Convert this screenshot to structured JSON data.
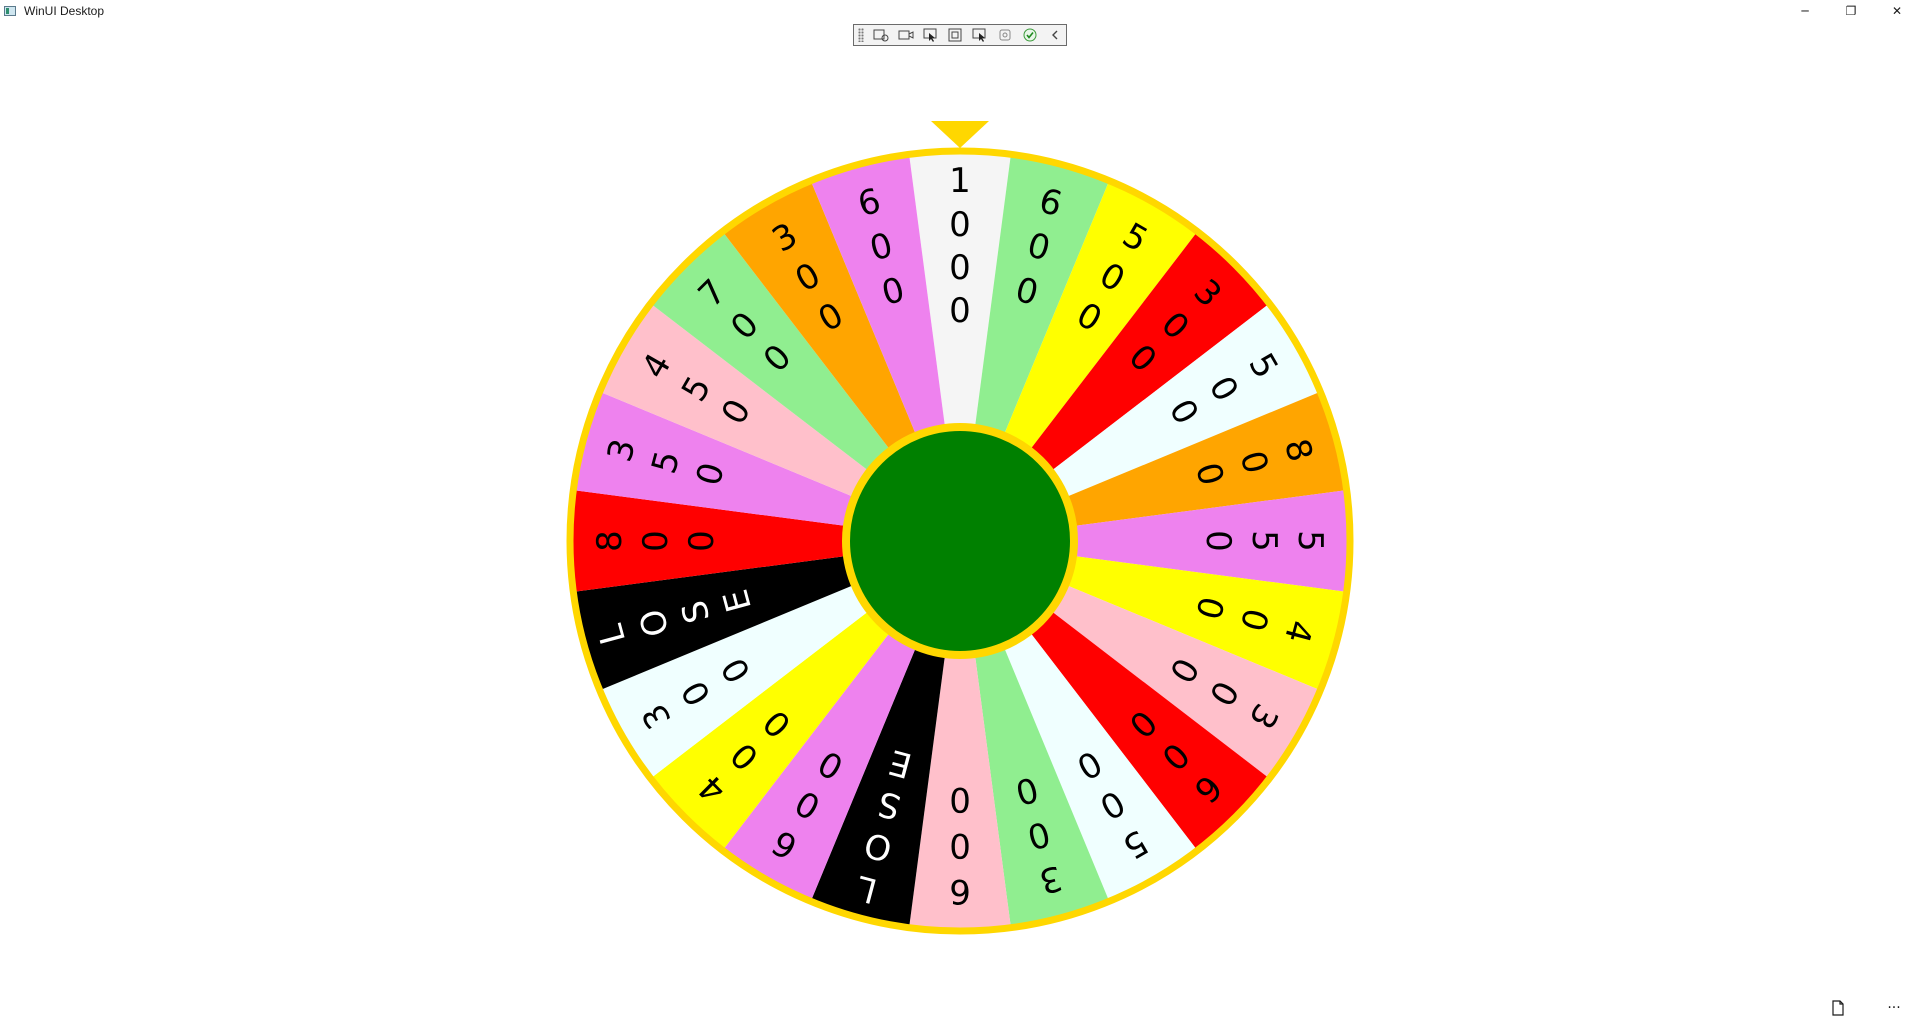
{
  "window": {
    "title": "WinUI Desktop"
  },
  "caption": {
    "minimize": "─",
    "restore": "❐",
    "close": "✕"
  },
  "toolbar": {
    "icons": [
      "grip-icon",
      "inspect-tree-icon",
      "video-icon",
      "select-element-icon",
      "display-layout-icon",
      "track-focus-icon",
      "hot-reload-icon",
      "ok-check-icon",
      "collapse-chevron-icon"
    ]
  },
  "wheel": {
    "rim_color": "#FFD700",
    "hub_color": "#008000",
    "pointer_color": "#FFD700",
    "segments": [
      {
        "label": "1000",
        "color": "#F5F5F5",
        "text_color": "#000000"
      },
      {
        "label": "600",
        "color": "#90EE90",
        "text_color": "#000000"
      },
      {
        "label": "500",
        "color": "#FFFF00",
        "text_color": "#000000"
      },
      {
        "label": "300",
        "color": "#FF0000",
        "text_color": "#000000"
      },
      {
        "label": "500",
        "color": "#F0FFFF",
        "text_color": "#000000"
      },
      {
        "label": "800",
        "color": "#FFA500",
        "text_color": "#000000"
      },
      {
        "label": "550",
        "color": "#EE82EE",
        "text_color": "#000000"
      },
      {
        "label": "400",
        "color": "#FFFF00",
        "text_color": "#000000"
      },
      {
        "label": "300",
        "color": "#FFC0CB",
        "text_color": "#000000"
      },
      {
        "label": "600",
        "color": "#FF0000",
        "text_color": "#000000"
      },
      {
        "label": "500",
        "color": "#F0FFFF",
        "text_color": "#000000"
      },
      {
        "label": "300",
        "color": "#90EE90",
        "text_color": "#000000"
      },
      {
        "label": "600",
        "color": "#FFC0CB",
        "text_color": "#000000"
      },
      {
        "label": "LOSE",
        "color": "#000000",
        "text_color": "#FFFFFF"
      },
      {
        "label": "600",
        "color": "#EE82EE",
        "text_color": "#000000"
      },
      {
        "label": "400",
        "color": "#FFFF00",
        "text_color": "#000000"
      },
      {
        "label": "300",
        "color": "#F0FFFF",
        "text_color": "#000000"
      },
      {
        "label": "LOSE",
        "color": "#000000",
        "text_color": "#FFFFFF"
      },
      {
        "label": "800",
        "color": "#FF0000",
        "text_color": "#000000"
      },
      {
        "label": "350",
        "color": "#EE82EE",
        "text_color": "#000000"
      },
      {
        "label": "450",
        "color": "#FFC0CB",
        "text_color": "#000000"
      },
      {
        "label": "700",
        "color": "#90EE90",
        "text_color": "#000000"
      },
      {
        "label": "300",
        "color": "#FFA500",
        "text_color": "#000000"
      },
      {
        "label": "600",
        "color": "#EE82EE",
        "text_color": "#000000"
      }
    ]
  },
  "footer": {
    "page_icon": "document-icon",
    "more_label": "···"
  }
}
